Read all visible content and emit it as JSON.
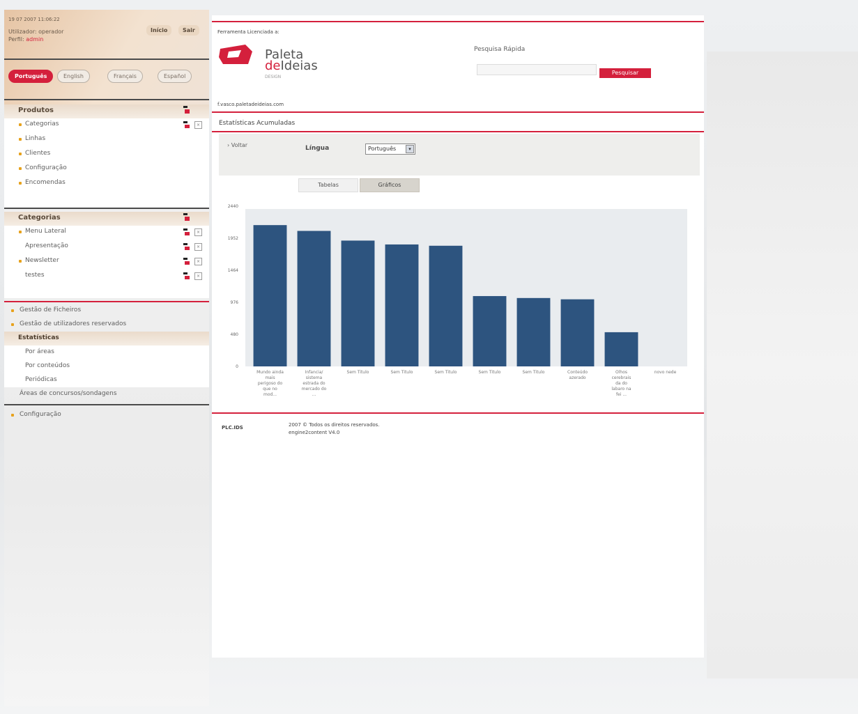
{
  "sidebar": {
    "datetime": "19 07 2007 11:06:22",
    "user_label": "Utilizador: operador",
    "profile_label": "Perfil:",
    "profile_value": "admin",
    "start_btn": "Início",
    "logout_btn": "Sair",
    "languages": [
      "Português",
      "English",
      "Français",
      "Español"
    ],
    "products": {
      "title": "Produtos",
      "items": [
        "Categorias",
        "Linhas",
        "Clientes",
        "Configuração",
        "Encomendas"
      ]
    },
    "categories": {
      "title": "Categorias",
      "items": [
        "Menu Lateral",
        "Apresentação",
        "Newsletter",
        "testes"
      ]
    },
    "menu": {
      "files": "Gestão de Ficheiros",
      "reserved_users": "Gestão de utilizadores reservados",
      "stats": "Estatísticas",
      "stats_items": [
        "Por áreas",
        "Por conteúdos",
        "Periódicas"
      ],
      "contests": "Áreas de concursos/sondagens",
      "config": "Configuração"
    }
  },
  "main": {
    "license": "Ferramenta Licenciada a:",
    "brand_line1": "Paleta",
    "brand_de": "de",
    "brand_ideias": "Ideias",
    "brand_sub": "DESIGN",
    "quick_search_label": "Pesquisa Rápida",
    "quick_search_btn": "Pesquisar",
    "email": "f.vasco.paletadeideias.com",
    "section_title": "Estatísticas Acumuladas",
    "back": "› Voltar",
    "language_label": "Língua",
    "language_value": "Português",
    "tabs": [
      "Tabelas",
      "Gráficos"
    ],
    "footer_logo": "PLC.IDS",
    "footer_copy": "2007 © Todos os direitos reservados.",
    "footer_engine": "engine2content V4.0"
  },
  "chart_data": {
    "type": "bar",
    "categories": [
      "Mundo ainda mais perigoso do que no mod...",
      "Infancia/ sistema estrada do mercado do ...",
      "Sem Titulo",
      "Sem Titulo",
      "Sem Titulo",
      "Sem Titulo",
      "Sem Titulo",
      "Conteúdo azerado",
      "Olhos cerebrais da do labaro na fei ...",
      "novo nede"
    ],
    "values": [
      2190,
      2100,
      1950,
      1890,
      1870,
      1090,
      1060,
      1040,
      530,
      0
    ],
    "y_ticks": [
      "0",
      "480",
      "976",
      "1464",
      "1952",
      "2440"
    ],
    "ylim": [
      0,
      2440
    ],
    "bar_color": "#2d547f",
    "plot_bg": "#e9ecef"
  },
  "colors": {
    "accent": "#d4203c",
    "bar": "#2d547f"
  }
}
